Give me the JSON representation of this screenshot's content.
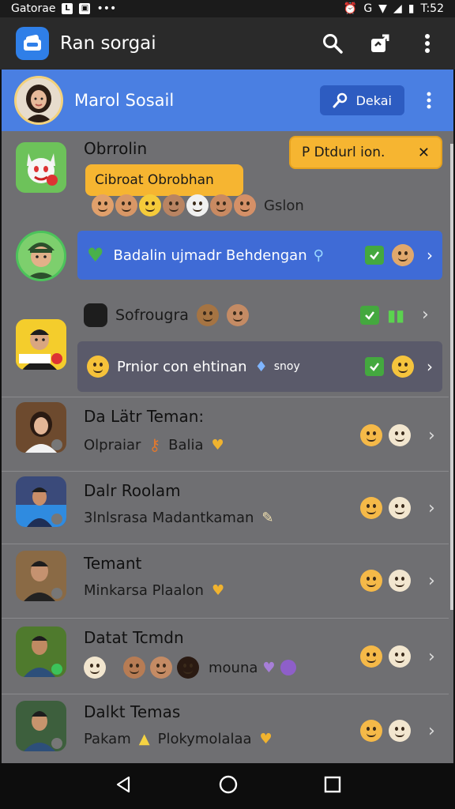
{
  "status_bar": {
    "carrier": "Gatorae",
    "icon_a": "L",
    "dots": "•••",
    "time": "T:52"
  },
  "app_bar": {
    "title": "Ran sorgai"
  },
  "profile": {
    "name": "Marol Sosail",
    "button_label": "Dekai"
  },
  "notice": {
    "label": "P Dtdurl ion."
  },
  "rows": [
    {
      "title": "Obrrolin",
      "bubble": "Cibroat Obrobhan",
      "tail": "Gslon",
      "emoji_count": "6"
    },
    {
      "bar_text": "Badalin ujmadr Behdengan"
    },
    {
      "title": "Sofrougra",
      "bar_text": "Prnior con ehtinan",
      "bar_tail": "snoy"
    },
    {
      "title": "Da Lätr Teman:",
      "sub_a": "Olpraiar",
      "sub_b": "Balia"
    },
    {
      "title": "Dalr Roolam",
      "sub_a": "3lnlsrasa Madantkaman"
    },
    {
      "title": "Temant",
      "sub_a": "Minkarsa Plaalon"
    },
    {
      "title": "Datat Tcmdn",
      "sub_a": "mouna"
    },
    {
      "title": "Dalkt Temas",
      "sub_a": "Pakam",
      "sub_b": "Plokymolalaa"
    }
  ],
  "colors": {
    "accent": "#4a7fe2",
    "bubble": "#f6b531",
    "bar": "#3f6bd6"
  }
}
